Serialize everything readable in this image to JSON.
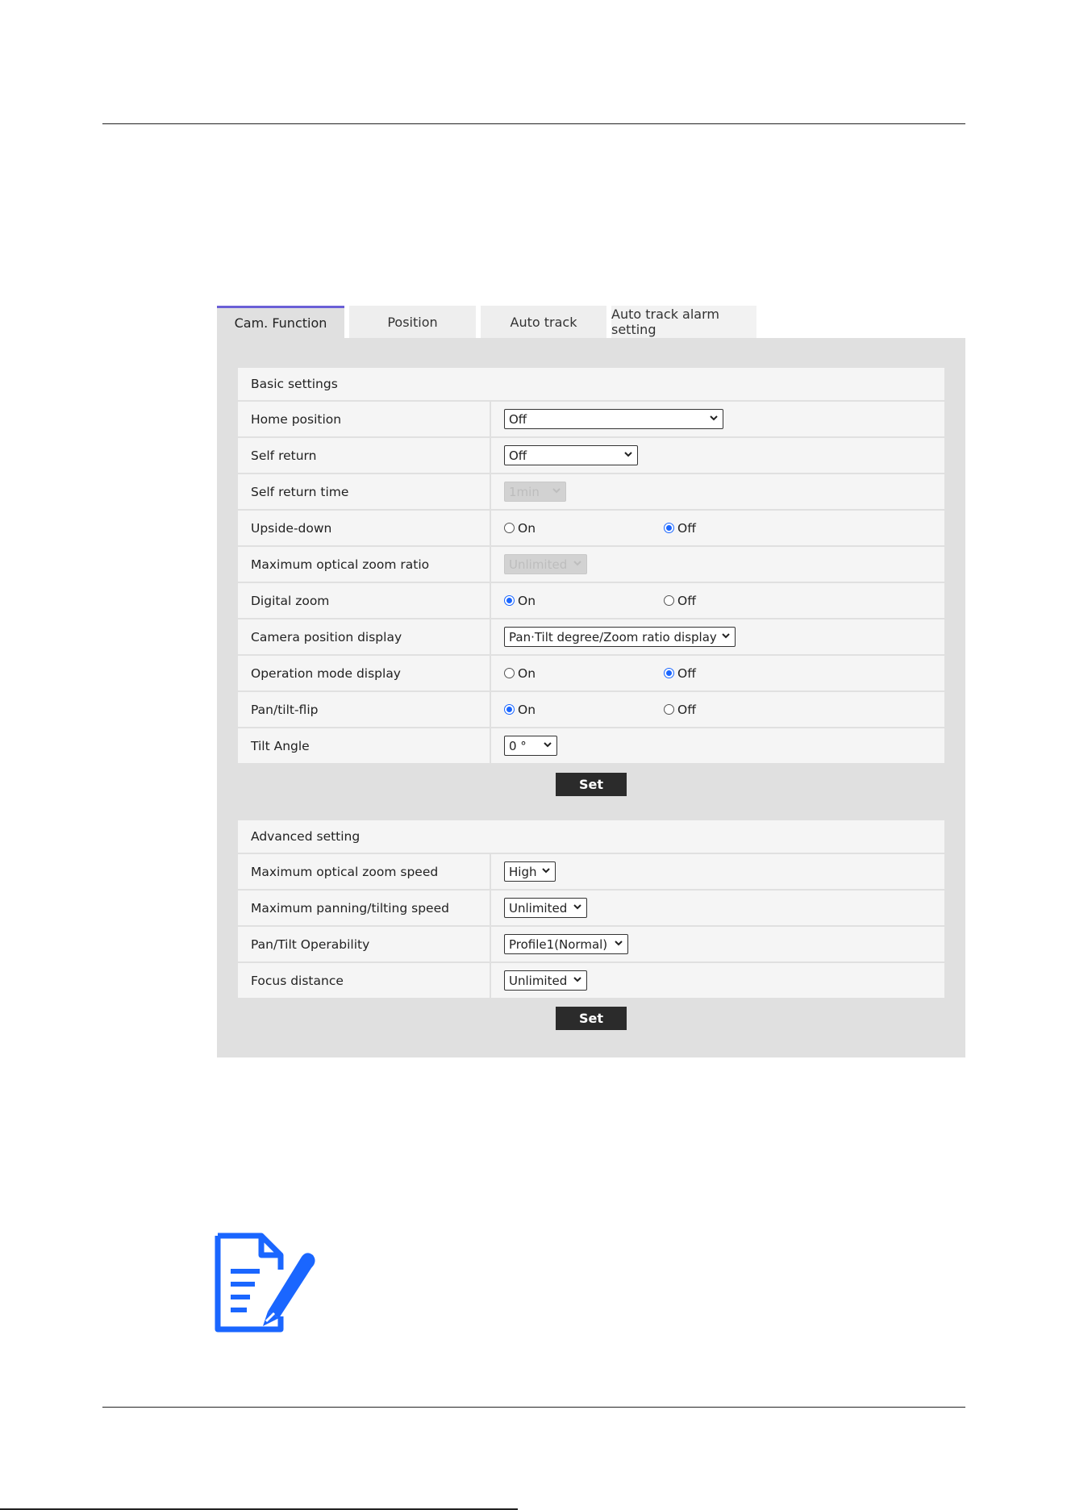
{
  "tabs": [
    {
      "label": "Cam. Function",
      "active": true
    },
    {
      "label": "Position",
      "active": false
    },
    {
      "label": "Auto track",
      "active": false
    },
    {
      "label": "Auto track alarm setting",
      "active": false
    }
  ],
  "basic": {
    "header": "Basic settings",
    "home_position": {
      "label": "Home position",
      "value": "Off"
    },
    "self_return": {
      "label": "Self return",
      "value": "Off"
    },
    "self_return_time": {
      "label": "Self return time",
      "value": "1min"
    },
    "upside_down": {
      "label": "Upside-down",
      "on": "On",
      "off": "Off",
      "selected": "Off"
    },
    "max_optical_zoom_ratio": {
      "label": "Maximum optical zoom ratio",
      "value": "Unlimited"
    },
    "digital_zoom": {
      "label": "Digital zoom",
      "on": "On",
      "off": "Off",
      "selected": "On"
    },
    "camera_position_display": {
      "label": "Camera position display",
      "value": "Pan·Tilt degree/Zoom ratio display"
    },
    "operation_mode_display": {
      "label": "Operation mode display",
      "on": "On",
      "off": "Off",
      "selected": "Off"
    },
    "pan_tilt_flip": {
      "label": "Pan/tilt-flip",
      "on": "On",
      "off": "Off",
      "selected": "On"
    },
    "tilt_angle": {
      "label": "Tilt Angle",
      "value": "0 °"
    },
    "set_label": "Set"
  },
  "advanced": {
    "header": "Advanced setting",
    "max_optical_zoom_speed": {
      "label": "Maximum optical zoom speed",
      "value": "High"
    },
    "max_pan_tilt_speed": {
      "label": "Maximum panning/tilting speed",
      "value": "Unlimited"
    },
    "pan_tilt_operability": {
      "label": "Pan/Tilt Operability",
      "value": "Profile1(Normal)"
    },
    "focus_distance": {
      "label": "Focus distance",
      "value": "Unlimited"
    },
    "set_label": "Set"
  },
  "icons": {
    "note": "note-pen-icon",
    "chevron": "chevron-down-icon",
    "accent": "#1a66ff",
    "tab_accent": "#6a5fd6"
  }
}
